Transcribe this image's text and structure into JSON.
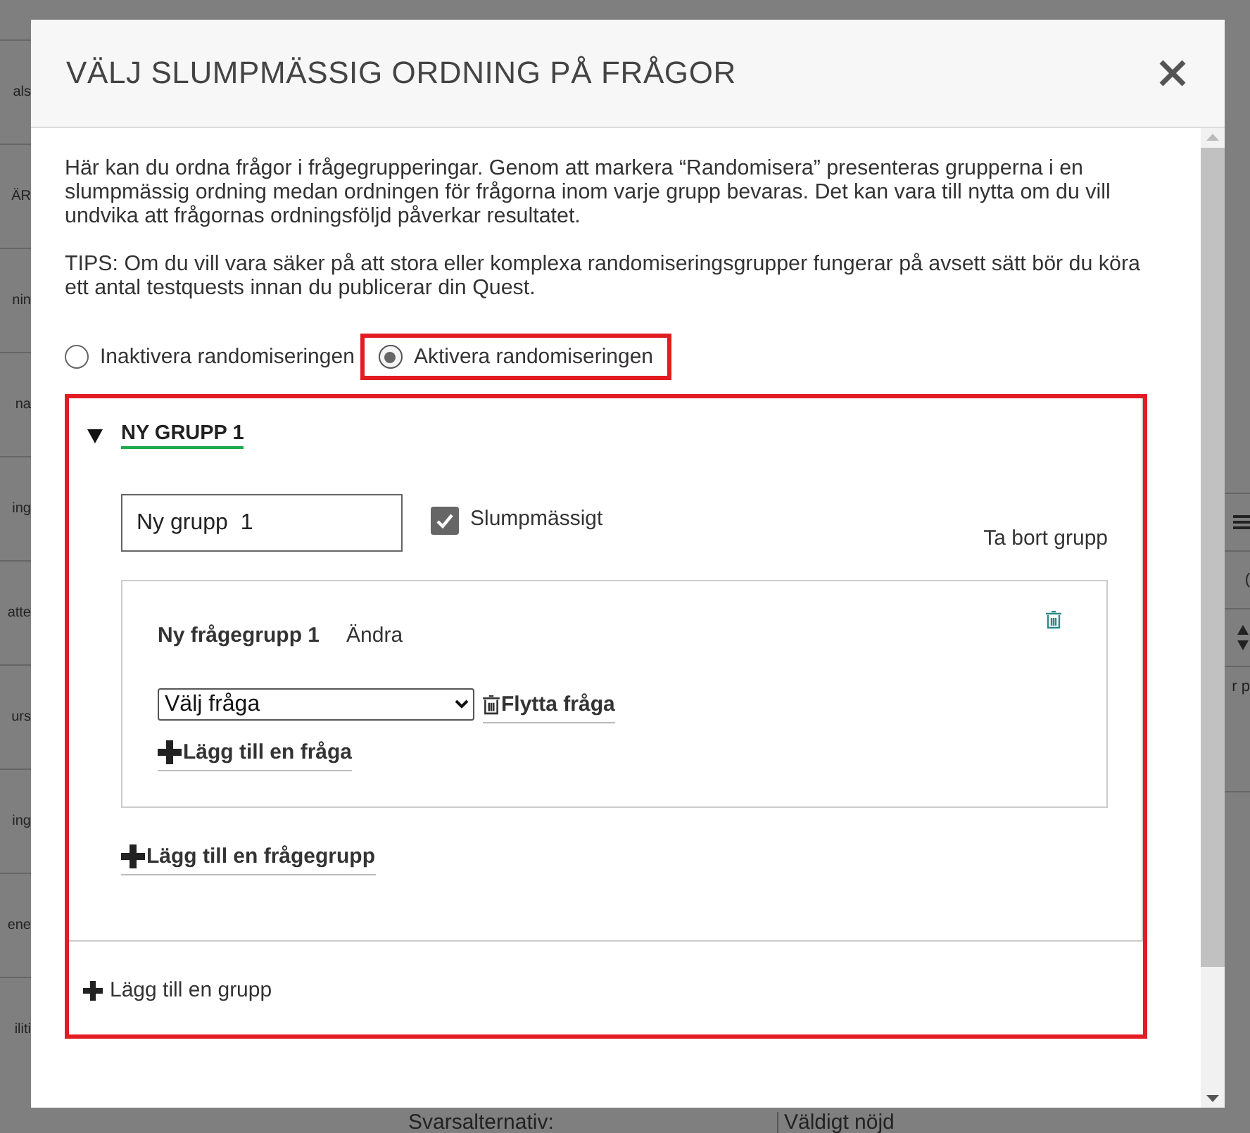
{
  "background": {
    "left_fragments": [
      "als",
      "ÄR",
      "nin",
      "na",
      "ing",
      "atte",
      "urs",
      "ing",
      "ene",
      "iliti"
    ],
    "right_fragments": [
      "(",
      "r p"
    ],
    "bottom": {
      "label": "Svarsalternativ:",
      "value": "Väldigt nöjd"
    }
  },
  "dialog": {
    "title": "VÄLJ SLUMPMÄSSIG ORDNING PÅ FRÅGOR",
    "intro": "Här kan du ordna frågor i frågegrupperingar. Genom att markera “Randomisera” presenteras grupperna i en slumpmässig ordning medan ordningen för frågorna inom varje grupp bevaras. Det kan vara till nytta om du vill undvika att frågornas ordningsföljd påverkar resultatet.",
    "tips": "TIPS: Om du vill vara säker på att stora eller komplexa randomiseringsgrupper fungerar på avsett sätt bör du köra ett antal testquests innan du publicerar din Quest.",
    "modes": [
      {
        "label": "Inaktivera randomiseringen",
        "selected": false,
        "highlighted": false
      },
      {
        "label": "Aktivera randomiseringen",
        "selected": true,
        "highlighted": true
      }
    ],
    "groups_highlighted": true,
    "groups": [
      {
        "title": "NY GRUPP 1",
        "expanded": true,
        "name_value": "Ny grupp  1",
        "random_label": "Slumpmässigt",
        "random_checked": true,
        "remove_label": "Ta bort grupp",
        "question_groups": [
          {
            "name": "Ny frågegrupp 1",
            "edit_label": "Ändra",
            "question_select": "Välj fråga",
            "move_label": "Flytta fråga",
            "add_question_label": "Lägg till en fråga"
          }
        ],
        "add_question_group_label": "Lägg till en frågegrupp"
      }
    ],
    "add_group_label": "Lägg till en grupp"
  }
}
